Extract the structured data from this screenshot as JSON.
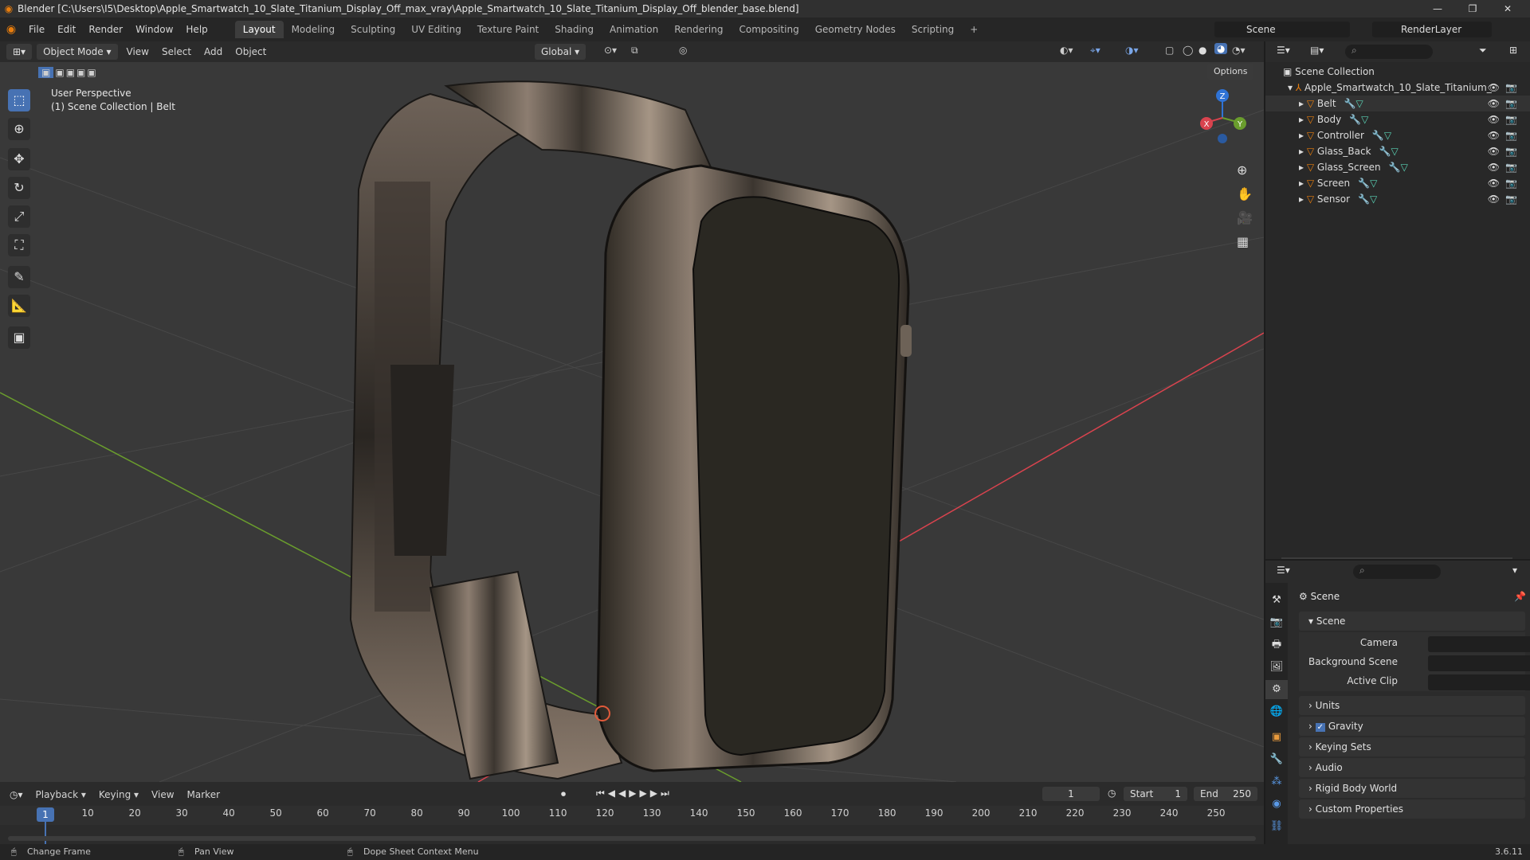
{
  "window": {
    "title": "Blender [C:\\Users\\I5\\Desktop\\Apple_Smartwatch_10_Slate_Titanium_Display_Off_max_vray\\Apple_Smartwatch_10_Slate_Titanium_Display_Off_blender_base.blend]"
  },
  "menus": [
    "File",
    "Edit",
    "Render",
    "Window",
    "Help"
  ],
  "workspaces": [
    "Layout",
    "Modeling",
    "Sculpting",
    "UV Editing",
    "Texture Paint",
    "Shading",
    "Animation",
    "Rendering",
    "Compositing",
    "Geometry Nodes",
    "Scripting"
  ],
  "workspace_add": "+",
  "scene_name": "Scene",
  "render_layer": "RenderLayer",
  "viewport": {
    "mode": "Object Mode",
    "menus": [
      "View",
      "Select",
      "Add",
      "Object"
    ],
    "transform": "Global",
    "options": "Options",
    "perspective": "User Perspective",
    "collection": "(1) Scene Collection | Belt",
    "gizmo": {
      "z": "Z",
      "y": "Y",
      "x": "X"
    }
  },
  "outliner": {
    "root": "Scene Collection",
    "collection": "Apple_Smartwatch_10_Slate_Titanium_",
    "items": [
      "Belt",
      "Body",
      "Controller",
      "Glass_Back",
      "Glass_Screen",
      "Screen",
      "Sensor"
    ]
  },
  "properties": {
    "title": "Scene",
    "section": "Scene",
    "fields": {
      "camera": "Camera",
      "background": "Background Scene",
      "clip": "Active Clip"
    },
    "panels": [
      "Units",
      "Gravity",
      "Keying Sets",
      "Audio",
      "Rigid Body World",
      "Custom Properties"
    ]
  },
  "timeline": {
    "menus": [
      "Playback",
      "Keying",
      "View",
      "Marker"
    ],
    "current": "1",
    "start_label": "Start",
    "start": "1",
    "end_label": "End",
    "end": "250",
    "ticks": [
      "1",
      "10",
      "20",
      "30",
      "40",
      "50",
      "60",
      "70",
      "80",
      "90",
      "100",
      "110",
      "120",
      "130",
      "140",
      "150",
      "160",
      "170",
      "180",
      "190",
      "200",
      "210",
      "220",
      "230",
      "240",
      "250"
    ]
  },
  "status": {
    "left": "Change Frame",
    "middle": "Pan View",
    "right": "Dope Sheet Context Menu",
    "version": "3.6.11"
  },
  "icons": {
    "blender": "blender-logo-icon",
    "eye": "eye-icon",
    "camera": "camera-icon",
    "mesh": "mesh-triangle-icon"
  },
  "colors": {
    "accent": "#4772b3",
    "orange": "#e87d0d",
    "axis_x": "#d9434e",
    "axis_y": "#6a9d2d",
    "axis_z": "#2f73d6"
  }
}
